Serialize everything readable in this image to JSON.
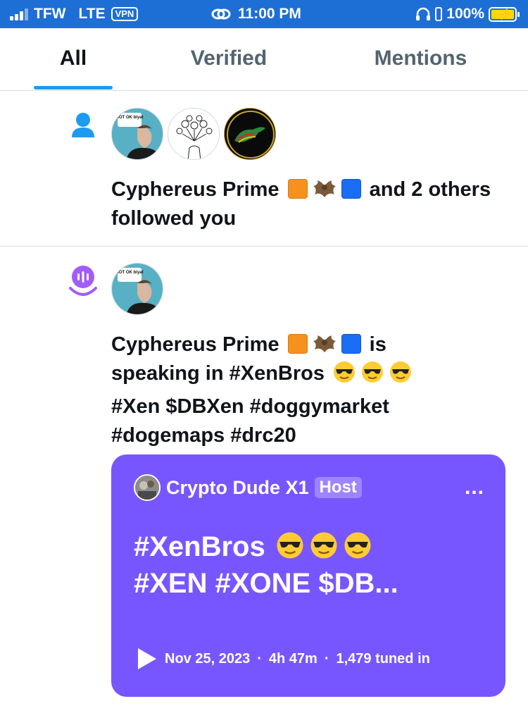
{
  "status_bar": {
    "carrier": "TFW",
    "network": "LTE",
    "vpn": "VPN",
    "time": "11:00 PM",
    "battery": "100%"
  },
  "tabs": [
    {
      "label": "All",
      "active": true
    },
    {
      "label": "Verified",
      "active": false
    },
    {
      "label": "Mentions",
      "active": false
    }
  ],
  "notifications": [
    {
      "type": "follow",
      "icon": "person-icon",
      "name": "Cyphereus Prime",
      "rest": "and 2 others followed you",
      "avatar_caption": "NOT OK blyat"
    },
    {
      "type": "space",
      "icon": "spaces-microphone-icon",
      "name": "Cyphereus Prime",
      "rest_line1": "is",
      "rest_line2": "speaking in #XenBros",
      "tags_line3": "#Xen $DBXen #doggymarket",
      "tags_line4": "#dogemaps #drc20",
      "avatar_caption": "NOT OK blyat",
      "space": {
        "host_name": "Crypto Dude X1",
        "host_badge": "Host",
        "more": "...",
        "title_line1": "#XenBros",
        "title_line2": "#XEN #XONE  $DB...",
        "date": "Nov 25, 2023",
        "duration": "4h 47m",
        "tuned_in": "1,479 tuned in"
      }
    }
  ],
  "colors": {
    "status_bar": "#1d6fd6",
    "accent": "#1d9bf0",
    "spaces_purple": "#7856ff",
    "spaces_icon": "#a25cf8"
  }
}
